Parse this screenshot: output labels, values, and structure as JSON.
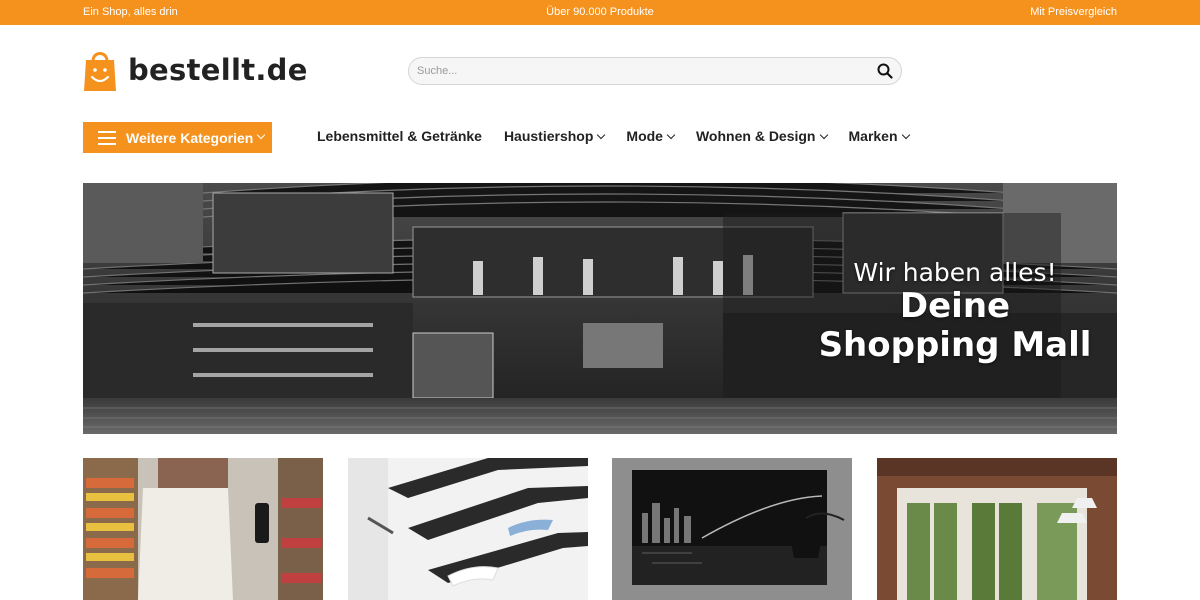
{
  "topbar": {
    "left": "Ein Shop, alles drin",
    "center": "Über 90.000 Produkte",
    "right": "Mit Preisvergleich"
  },
  "brand": {
    "name": "bestellt.de",
    "color": "#f5921e",
    "logo_icon": "shopping-bag-smile-icon"
  },
  "search": {
    "placeholder": "Suche...",
    "value": "",
    "icon": "search-icon"
  },
  "categories_button": {
    "label": "Weitere Kategorien",
    "icon": "hamburger-menu-icon"
  },
  "nav": {
    "items": [
      {
        "label": "Lebensmittel & Getränke",
        "has_dropdown": false
      },
      {
        "label": "Haustiershop",
        "has_dropdown": true
      },
      {
        "label": "Mode",
        "has_dropdown": true
      },
      {
        "label": "Wohnen & Design",
        "has_dropdown": true
      },
      {
        "label": "Marken",
        "has_dropdown": true
      }
    ]
  },
  "hero": {
    "subtitle": "Wir haben alles!",
    "title_line1": "Deine",
    "title_line2": "Shopping Mall"
  },
  "tiles": [
    {
      "image": "supermarket-shopping-photo"
    },
    {
      "image": "shelves-with-towels-photo"
    },
    {
      "image": "city-skyline-picture-and-lamp-photo"
    },
    {
      "image": "garden-pavilion-photo"
    }
  ]
}
